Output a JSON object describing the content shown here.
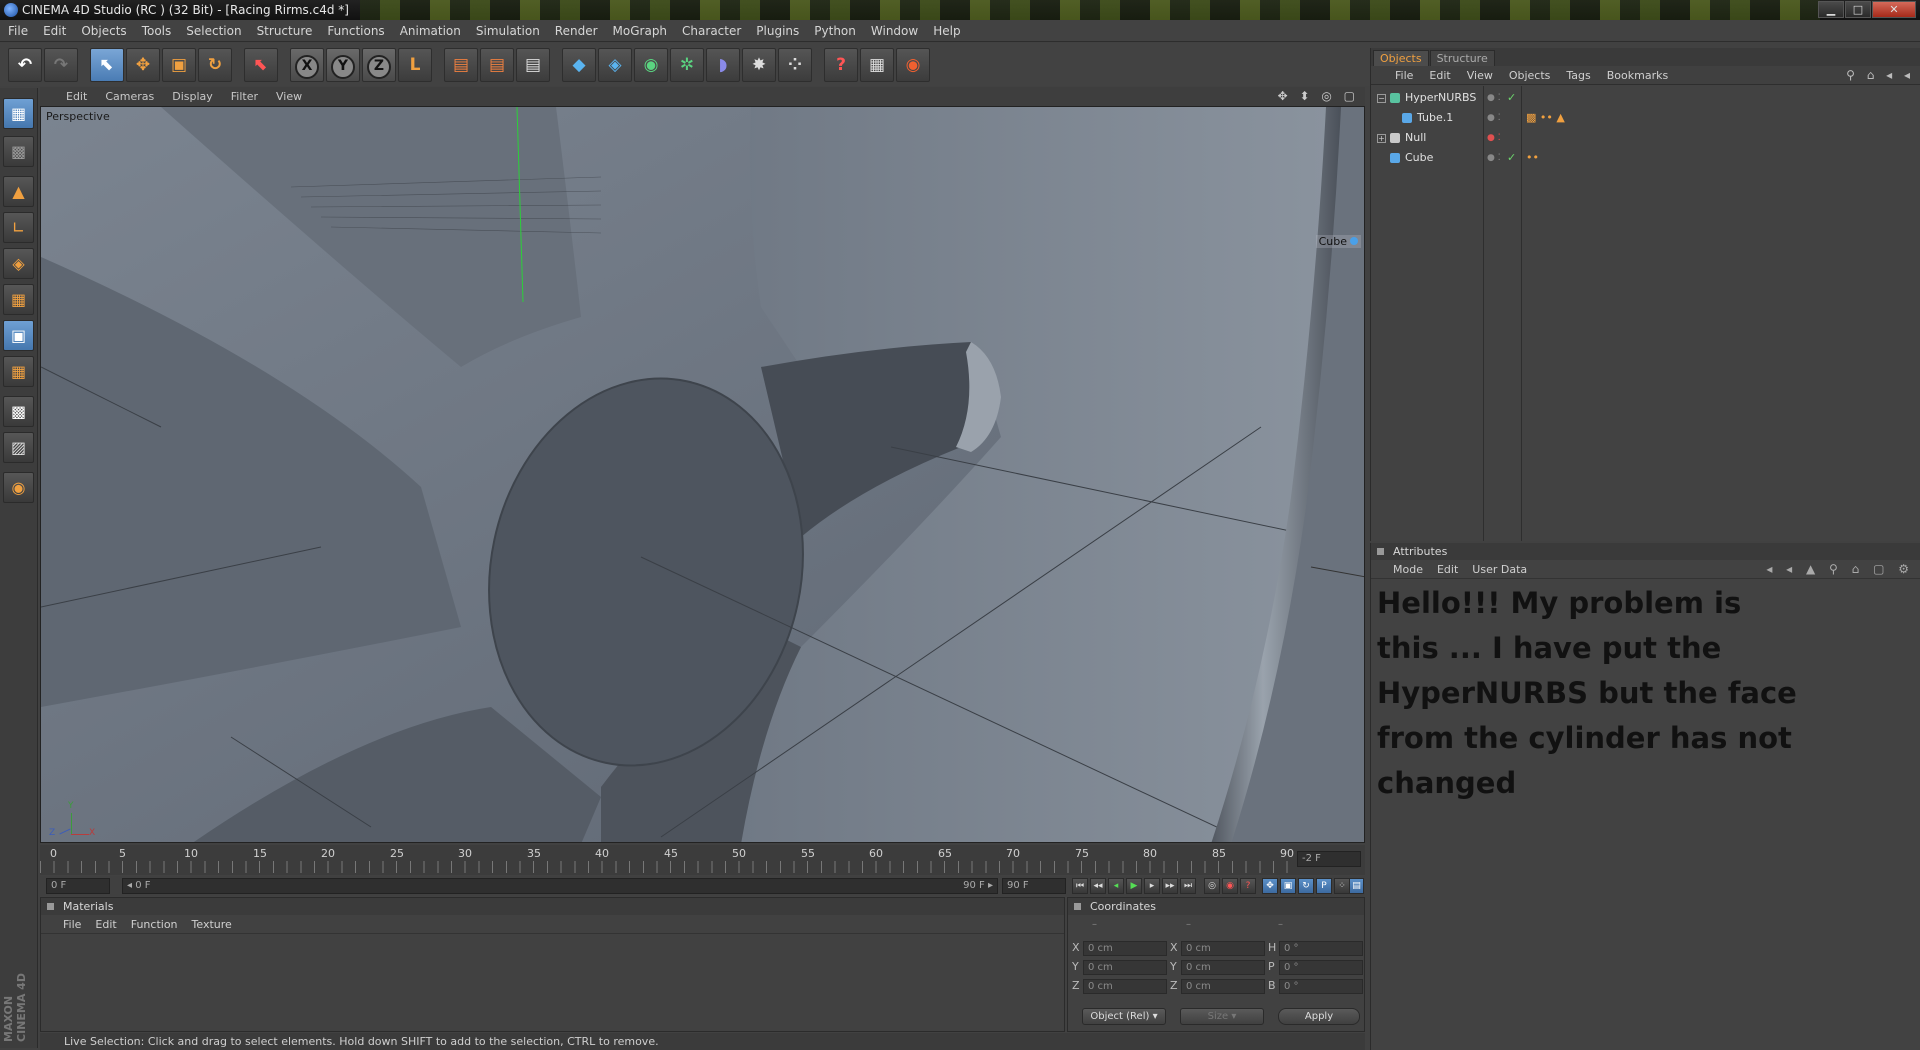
{
  "window": {
    "title": "CINEMA 4D Studio (RC ) (32 Bit) - [Racing Rirms.c4d *]",
    "minimize": "▁",
    "maximize": "□",
    "close": "✕"
  },
  "menubar": [
    "File",
    "Edit",
    "Objects",
    "Tools",
    "Selection",
    "Structure",
    "Functions",
    "Animation",
    "Simulation",
    "Render",
    "MoGraph",
    "Character",
    "Plugins",
    "Python",
    "Window",
    "Help"
  ],
  "toolbar": {
    "undo": "↶",
    "redo": "↷",
    "live_select": "⬉",
    "move": "✥",
    "scale": "▣",
    "rotate": "↻",
    "recent": "⬉",
    "x_axis": "X",
    "y_axis": "Y",
    "z_axis": "Z",
    "coord": "L",
    "render_view": "▤",
    "render_pic": "▤",
    "render_settings": "▤",
    "cube": "◆",
    "nurbs": "◈",
    "array": "◉",
    "atom": "✲",
    "deformer": "◗",
    "scene": "✸",
    "particles": "⁘",
    "help": "?",
    "layout": "▦",
    "web": "◉"
  },
  "left_toolbar": {
    "make_editable": "▦",
    "texture": "▩",
    "points": "▲",
    "edges": "∟",
    "polygons": "◈",
    "model": "▦",
    "object": "▣",
    "workplane": "▦",
    "axis": "▩",
    "enable_axis": "▨",
    "snap": "◉",
    "brand": "MAXON CINEMA 4D"
  },
  "viewport": {
    "menu": [
      "Edit",
      "Cameras",
      "Display",
      "Filter",
      "View"
    ],
    "nav_icons": "✥ ⬍ ◎ ▢",
    "label": "Perspective",
    "selected_object_label": "Cube",
    "axis_y": "Y",
    "axis_x": "X",
    "axis_z": "Z"
  },
  "timeline": {
    "ticks": [
      "0",
      "5",
      "10",
      "15",
      "20",
      "25",
      "30",
      "35",
      "40",
      "45",
      "50",
      "55",
      "60",
      "65",
      "70",
      "75",
      "80",
      "85",
      "90"
    ],
    "current_frame": "-2 F"
  },
  "animbar": {
    "start": "0 F",
    "range_start": "◂ 0 F",
    "range_end": "90 F ▸",
    "end": "90 F",
    "btn_first": "⏮",
    "btn_prev_key": "◂◂",
    "btn_prev": "◂",
    "btn_play": "▶",
    "btn_next": "▸",
    "btn_next_key": "▸▸",
    "btn_last": "⏭",
    "btn_rec_a": "◎",
    "btn_rec_b": "◉",
    "btn_rec_c": "?",
    "btn_k1": "✥",
    "btn_k2": "▣",
    "btn_k3": "↻",
    "btn_k4": "P",
    "btn_k5": "⁘",
    "btn_k6": "▦",
    "btn_k7": "▤"
  },
  "materials": {
    "title": "Materials",
    "menu": [
      "File",
      "Edit",
      "Function",
      "Texture"
    ]
  },
  "coordinates": {
    "title": "Coordinates",
    "col_heads": [
      "–",
      "–",
      "–"
    ],
    "rows": [
      {
        "l1": "X",
        "v1": "0 cm",
        "l2": "X",
        "v2": "0 cm",
        "l3": "H",
        "v3": "0 °"
      },
      {
        "l1": "Y",
        "v1": "0 cm",
        "l2": "Y",
        "v2": "0 cm",
        "l3": "P",
        "v3": "0 °"
      },
      {
        "l1": "Z",
        "v1": "0 cm",
        "l2": "Z",
        "v2": "0 cm",
        "l3": "B",
        "v3": "0 °"
      }
    ],
    "mode": "Object (Rel) ▾",
    "size_mode": "Size ▾",
    "apply": "Apply"
  },
  "status": "Live Selection: Click and drag to select elements. Hold down SHIFT to add to the selection, CTRL to remove.",
  "object_manager": {
    "tabs": [
      "Objects",
      "Structure"
    ],
    "menu": [
      "File",
      "Edit",
      "View",
      "Objects",
      "Tags",
      "Bookmarks"
    ],
    "icons": "⚲ ⌂ ◂ ◂",
    "objects": [
      {
        "name": "HyperNURBS",
        "tree": "−",
        "dots": "● ⁚",
        "check": "✓",
        "tags": "",
        "color": "#59c3a0"
      },
      {
        "name": "Tube.1",
        "tree": "",
        "dots": "● ⁚",
        "check": "",
        "tags": "▩ •• ▲",
        "color": "#5aa8e8"
      },
      {
        "name": "Null",
        "tree": "+",
        "dots": "● ⁚",
        "check": "",
        "tags": "",
        "color": "#c9c9c9"
      },
      {
        "name": "Cube",
        "tree": "",
        "dots": "● ⁚",
        "check": "✓",
        "tags": "••",
        "color": "#5aa8e8"
      }
    ]
  },
  "attributes": {
    "title": "Attributes",
    "menu": [
      "Mode",
      "Edit",
      "User Data"
    ],
    "icons": "◂ ◂ ▲ ⚲ ⌂ ▢ ⚙",
    "message": "Hello!!! My problem is this ... I have put the HyperNURBS but the face from the cylinder has not changed"
  },
  "colors": {
    "accent": "#f0a040",
    "active_tool": "#5b90c8",
    "panel_bg": "#424242",
    "viewport_bg": "#6e7782"
  }
}
